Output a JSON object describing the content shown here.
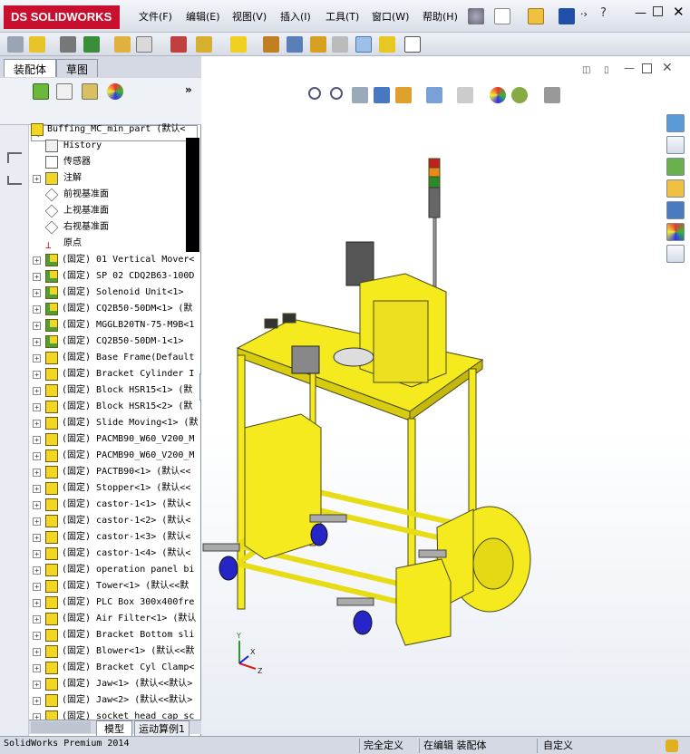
{
  "app": {
    "logo_text": "SOLIDWORKS",
    "brand_prefix": "DS",
    "accent": "#c8102e"
  },
  "menu": [
    "文件(F)",
    "编辑(E)",
    "视图(V)",
    "插入(I)",
    "工具(T)",
    "窗口(W)",
    "帮助(H)"
  ],
  "manager_tabs": [
    "装配体",
    "草图"
  ],
  "tree": {
    "root": "Buffing_MC_min_part  (默认<",
    "features": [
      "History",
      "传感器",
      "注解",
      "前视基准面",
      "上视基准面",
      "右视基准面",
      "原点"
    ],
    "parts": [
      "(固定) 01 Vertical Mover<",
      "(固定) SP 02 CDQ2B63-100D",
      "(固定) Solenoid Unit<1>",
      "(固定) CQ2B50-50DM<1> (默",
      "(固定) MGGLB20TN-75-M9B<1",
      "(固定) CQ2B50-50DM-1<1>",
      "(固定) Base Frame(Default",
      "(固定) Bracket Cylinder I",
      "(固定) Block HSR15<1> (默",
      "(固定) Block HSR15<2> (默",
      "(固定) Slide Moving<1> (默",
      "(固定) PACMB90_W60_V200_M",
      "(固定) PACMB90_W60_V200_M",
      "(固定) PACTB90<1> (默认<<",
      "(固定) Stopper<1> (默认<<",
      "(固定) castor-1<1> (默认<",
      "(固定) castor-1<2> (默认<",
      "(固定) castor-1<3> (默认<",
      "(固定) castor-1<4> (默认<",
      "(固定) operation panel bi",
      "(固定) Tower<1> (默认<<默",
      "(固定) PLC Box 300x400fre",
      "(固定) Air Filter<1> (默认",
      "(固定) Bracket Bottom sli",
      "(固定) Blower<1> (默认<<默",
      "(固定) Bracket Cyl Clamp<",
      "(固定) Jaw<1> (默认<<默认>",
      "(固定) Jaw<2> (默认<<默认>",
      "(固定) socket head cap sc"
    ]
  },
  "bottom_tabs": [
    "模型",
    "运动算例1"
  ],
  "status": {
    "app_version": "SolidWorks Premium 2014",
    "definition": "完全定义",
    "editing": "在编辑 装配体",
    "custom": "自定义"
  },
  "colors": {
    "model_yellow": "#f5ea1e",
    "model_outline": "#4a4a1a",
    "wheel_blue": "#2626c8"
  }
}
